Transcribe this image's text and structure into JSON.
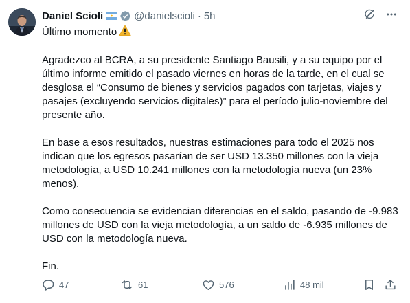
{
  "author": {
    "name": "Daniel Scioli",
    "handle": "@danielscioli",
    "separator": "·",
    "time": "5h"
  },
  "headline": "Último momento",
  "paragraphs": [
    "Agradezco al BCRA, a su presidente Santiago Bausili, y a su equipo por el último informe emitido el pasado viernes en horas de la tarde, en el cual se desglosa el “Consumo de bienes y servicios pagados con tarjetas, viajes y pasajes (excluyendo servicios digitales)” para el período julio-noviembre del presente año.",
    "En base a esos resultados, nuestras estimaciones para todo el 2025 nos indican que los egresos pasarían de ser USD 13.350 millones con la vieja metodología, a USD 10.241 millones con la metodología nueva (un 23% menos).",
    "Como consecuencia se evidencian diferencias en el saldo, pasando de -9.983 millones de USD con la vieja metodología, a un saldo de -6.935 millones de USD con la metodología nueva.",
    "Fin."
  ],
  "stats": {
    "replies": "47",
    "reposts": "61",
    "likes": "576",
    "views": "48 mil"
  },
  "icons": {
    "headline_emoji": "warning-emoji",
    "verified": "verified-badge-icon",
    "flag": "argentina-flag-icon",
    "grok": "grok-icon",
    "more": "more-icon",
    "reply": "reply-icon",
    "repost": "repost-icon",
    "like": "like-icon",
    "views": "views-icon",
    "bookmark": "bookmark-icon",
    "share": "share-icon"
  },
  "colors": {
    "text": "#0f1419",
    "secondary": "#536471",
    "verified_gray": "#829aab",
    "warning": "#f2b52e"
  }
}
